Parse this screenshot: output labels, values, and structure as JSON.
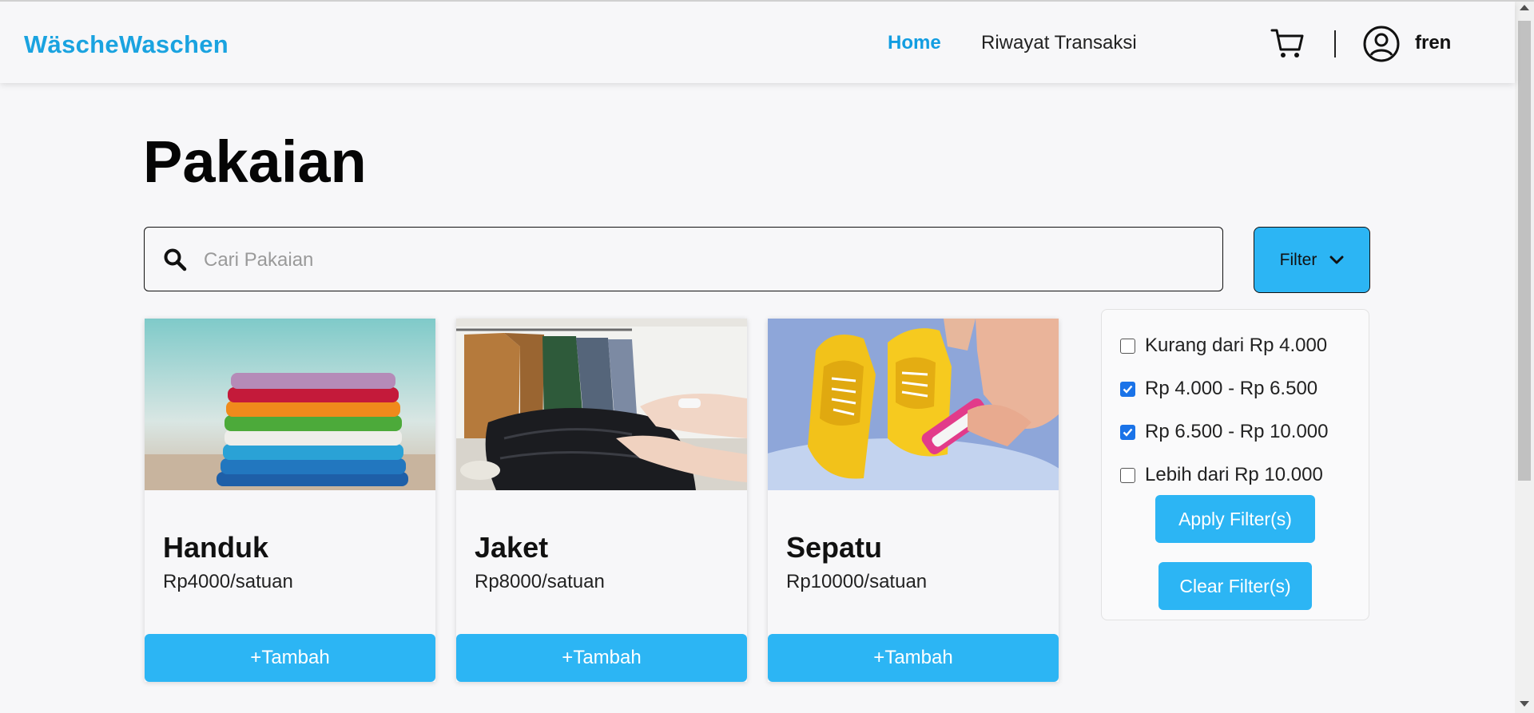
{
  "navbar": {
    "brand": "WäscheWaschen",
    "links": [
      {
        "label": "Home",
        "active": true
      },
      {
        "label": "Riwayat Transaksi",
        "active": false
      }
    ],
    "cart_icon": "shopping-cart-icon",
    "user_icon": "user-circle-icon",
    "username": "fren",
    "accent": "#129de1"
  },
  "page": {
    "title": "Pakaian"
  },
  "search": {
    "placeholder": "Cari Pakaian",
    "value": ""
  },
  "filter": {
    "button_label": "Filter",
    "options": [
      {
        "label": "Kurang dari Rp 4.000",
        "checked": false
      },
      {
        "label": "Rp 4.000 - Rp 6.500",
        "checked": true
      },
      {
        "label": "Rp 6.500 - Rp 10.000",
        "checked": true
      },
      {
        "label": "Lebih dari Rp 10.000",
        "checked": false
      }
    ],
    "apply_label": "Apply Filter(s)",
    "clear_label": "Clear Filter(s)"
  },
  "products": [
    {
      "name": "Handuk",
      "price": "Rp4000/satuan",
      "button": "+Tambah",
      "image": "stacked-towels"
    },
    {
      "name": "Jaket",
      "price": "Rp8000/satuan",
      "button": "+Tambah",
      "image": "jackets"
    },
    {
      "name": "Sepatu",
      "price": "Rp10000/satuan",
      "button": "+Tambah",
      "image": "yellow-sneakers-washing"
    }
  ],
  "colors": {
    "button_blue": "#2cb5f4",
    "checkbox_blue": "#1a73e8"
  }
}
